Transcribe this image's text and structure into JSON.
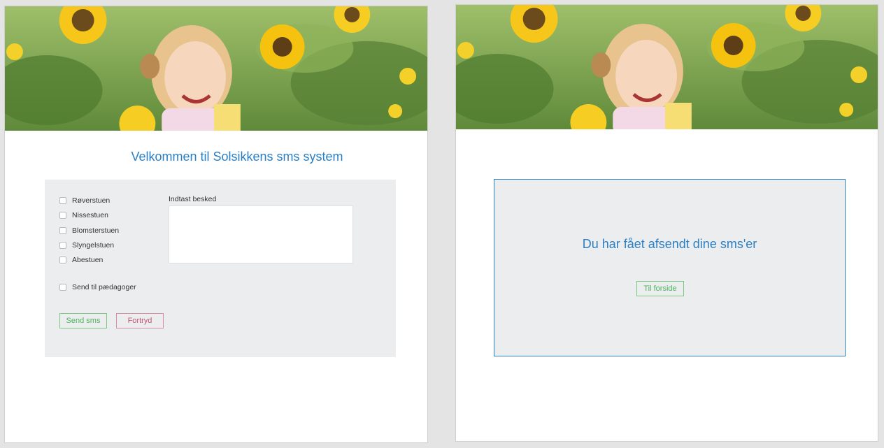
{
  "screen1": {
    "title": "Velkommen til Solsikkens sms system",
    "groups": [
      {
        "label": "Røverstuen",
        "checked": false
      },
      {
        "label": "Nissestuen",
        "checked": false
      },
      {
        "label": "Blomsterstuen",
        "checked": false
      },
      {
        "label": "Slyngelstuen",
        "checked": false
      },
      {
        "label": "Abestuen",
        "checked": false
      }
    ],
    "staff_option": {
      "label": "Send til pædagoger",
      "checked": false
    },
    "message": {
      "label": "Indtast besked",
      "value": ""
    },
    "send_button": "Send sms",
    "cancel_button": "Fortryd"
  },
  "screen2": {
    "confirmation": "Du har fået afsendt dine sms'er",
    "home_button": "Til forside"
  },
  "colors": {
    "accent_blue": "#2b7fc4",
    "green": "#4cb35a",
    "red": "#c0566f",
    "panel_bg": "#ecedef"
  }
}
